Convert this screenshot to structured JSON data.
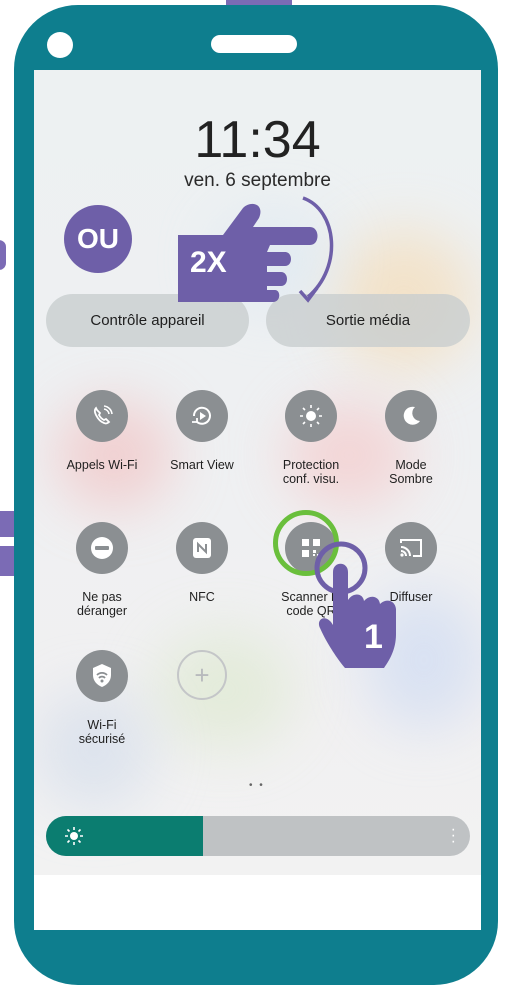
{
  "lockscreen": {
    "time": "11:34",
    "date": "ven. 6 septembre"
  },
  "buttons": {
    "device_control": "Contrôle appareil",
    "media_output": "Sortie média"
  },
  "tiles": [
    {
      "label": "Appels Wi-Fi",
      "icon": "wifi-call-icon",
      "active": false
    },
    {
      "label": "Smart View",
      "icon": "smart-view-icon",
      "active": false
    },
    {
      "label": "Protection\nconf. visu.",
      "icon": "eye-comfort-icon",
      "active": false
    },
    {
      "label": "Mode\nSombre",
      "icon": "moon-icon",
      "active": false
    },
    {
      "label": "Ne pas\ndéranger",
      "icon": "do-not-disturb-icon",
      "active": false
    },
    {
      "label": "NFC",
      "icon": "nfc-icon",
      "active": false
    },
    {
      "label": "Scanner le\ncode QR",
      "icon": "qr-code-icon",
      "active": false
    },
    {
      "label": "Diffuser",
      "icon": "cast-icon",
      "active": false
    },
    {
      "label": "Wi-Fi\nsécurisé",
      "icon": "secure-wifi-icon",
      "active": false
    }
  ],
  "add_tile_icon": "plus-icon",
  "brightness": {
    "level": 0.37,
    "icon": "sun-icon"
  },
  "page_indicator": "• •",
  "annotations": {
    "or_badge": "OU",
    "double_tap": "2X",
    "step_number": "1"
  },
  "colors": {
    "phone_frame": "#0e7e8e",
    "accent_purple": "#6e5fa8",
    "brightness_fill": "#0b7d70",
    "qr_highlight": "#6abf3c"
  }
}
